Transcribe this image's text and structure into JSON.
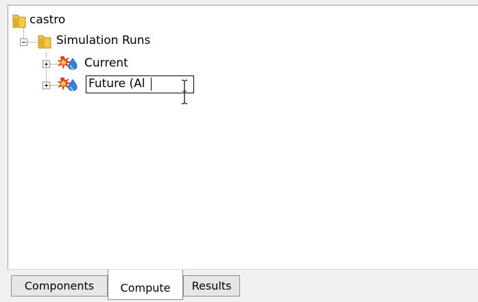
{
  "tree": {
    "root": {
      "label": "castro",
      "icon": "folder-icon"
    },
    "simulation_runs": {
      "label": "Simulation Runs",
      "icon": "folder-icon",
      "expanded": true
    },
    "runs": [
      {
        "label": "Current",
        "icon": "simulation-run-icon",
        "expanded": false
      },
      {
        "label": "Future (Al",
        "icon": "simulation-run-icon",
        "expanded": false,
        "editing": true
      }
    ]
  },
  "tabs": [
    {
      "label": "Components",
      "selected": false
    },
    {
      "label": "Compute",
      "selected": true
    },
    {
      "label": "Results",
      "selected": false
    }
  ],
  "colors": {
    "folder": "#e8b83a",
    "panel_border": "#a0a0a0",
    "tab_border": "#8c8c8c"
  }
}
